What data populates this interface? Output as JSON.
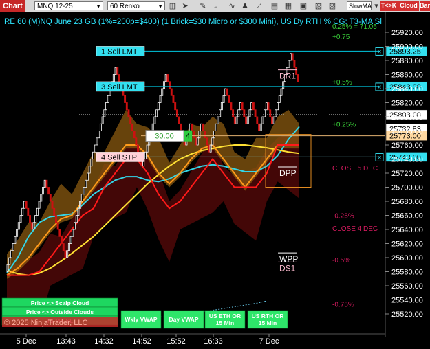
{
  "toolbar": {
    "app_label": "Chart",
    "instrument": "MNQ 12-25",
    "bar_type": "60 Renko",
    "indicator_select": "SlowMA",
    "btn_tk": "T<>K",
    "btn_cloud": "Cloud",
    "btn_bar": "Bar"
  },
  "colors": {
    "background": "#000000",
    "bull_brick": "#ffffff",
    "bear_brick": "#cc1111",
    "scalp_cloud": "#8a5a10",
    "outer_cloud": "#5a0a0a",
    "tenkan": "#ff9a1a",
    "kijun": "#ff1a1a",
    "ema_fast": "#33d6e8",
    "ema_slow": "#ffe033",
    "order_line": "#00c8e0",
    "price_tag_current": "#ffffff",
    "price_tag_open": "#ffd8a0",
    "accent_red": "#c62828"
  },
  "chart_data": {
    "type": "renko",
    "title": "RE 60 (M)NQ June 23 GB (1%=200p=$400) (1 Brick=$30 Micro or $300 Mini), US Dy RTH % CG: T3-MA Sl",
    "y_axis": {
      "ticks": [
        25920.0,
        25900.0,
        25880.0,
        25860.0,
        25840.0,
        25820.0,
        25800.0,
        25780.0,
        25760.0,
        25740.0,
        25720.0,
        25700.0,
        25680.0,
        25660.0,
        25640.0,
        25620.0,
        25600.0,
        25580.0,
        25560.0,
        25540.0,
        25520.0
      ],
      "range": [
        25510,
        25940
      ]
    },
    "x_axis": {
      "ticks": [
        "5 Dec",
        "13:43",
        "14:32",
        "14:52",
        "15:52",
        "16:33",
        "7 Dec"
      ]
    },
    "grid": false,
    "price_tags": [
      {
        "value": "25893.25",
        "style": "order"
      },
      {
        "value": "25843.00",
        "style": "order"
      },
      {
        "value": "25803.00",
        "style": "current"
      },
      {
        "value": "25782.83",
        "style": "current"
      },
      {
        "value": "25773.00",
        "style": "open"
      },
      {
        "value": "25743.00",
        "style": "order"
      }
    ],
    "orders": [
      {
        "label": "1 Sell LMT",
        "price": 25893.25
      },
      {
        "label": "3 Sell LMT",
        "price": 25843.0
      },
      {
        "label": "4 Sell STP",
        "price": 25743.0
      }
    ],
    "position_box": {
      "value": "30.00",
      "quantity": "4"
    },
    "levels": [
      {
        "label": "DR1",
        "price": 25856
      },
      {
        "label": "DPP",
        "price": 25718
      },
      {
        "label": "WPP",
        "price": 25596
      },
      {
        "label": "DS1",
        "price": 25583
      }
    ],
    "percent_labels": [
      {
        "label": "+0.75",
        "price": 25914,
        "color": "#3ad13a"
      },
      {
        "label": "+0.5%",
        "price": 25850,
        "color": "#3ad13a"
      },
      {
        "label": "+0.25%",
        "price": 25790,
        "color": "#3ad13a"
      },
      {
        "label": "-0.25%",
        "price": 25660,
        "color": "#d81b60"
      },
      {
        "label": "-0.5%",
        "price": 25597,
        "color": "#d81b60"
      },
      {
        "label": "-0.75%",
        "price": 25534,
        "color": "#d81b60"
      }
    ],
    "annotations": [
      {
        "label": "CLOSE 5 DEC",
        "price": 25728,
        "color": "#d81b60"
      },
      {
        "label": "CLOSE 4 DEC",
        "price": 25642,
        "color": "#d81b60"
      },
      {
        "label": "0.25% = 71.05",
        "price": 25929,
        "color": "#3ad13a"
      }
    ],
    "bricks": {
      "size": 10,
      "start": 25580,
      "moves": [
        1,
        1,
        1,
        1,
        1,
        1,
        1,
        1,
        1,
        1,
        -1,
        -1,
        -1,
        -1,
        1,
        1,
        1,
        1,
        1,
        1,
        1,
        -1,
        -1,
        -1,
        -1,
        -1,
        -1,
        -1,
        -1,
        -1,
        -1,
        -1,
        1,
        1,
        1,
        1,
        1,
        1,
        1,
        1,
        1,
        1,
        1,
        1,
        1,
        1,
        1,
        1,
        1,
        1,
        1,
        1,
        1,
        1,
        1,
        1,
        1,
        1,
        1,
        -1,
        -1,
        -1,
        -1,
        -1,
        -1,
        -1,
        -1,
        -1,
        -1,
        -1,
        -1,
        -1,
        -1,
        1,
        1,
        1,
        1,
        1,
        1,
        1,
        1,
        1,
        1,
        1,
        1,
        1,
        -1,
        -1,
        -1,
        -1,
        -1,
        -1,
        -1,
        -1,
        -1,
        -1,
        1,
        1,
        1,
        -1,
        -1,
        -1,
        1,
        1,
        1,
        -1,
        -1,
        -1,
        -1,
        1,
        1,
        1,
        1,
        1,
        1,
        1,
        1,
        1,
        -1,
        -1,
        -1,
        -1,
        -1,
        1,
        1,
        1,
        -1,
        -1,
        -1,
        1,
        1,
        1,
        -1,
        -1,
        -1,
        -1,
        1,
        1,
        1,
        1,
        -1,
        -1,
        -1,
        1,
        1,
        1,
        1,
        1,
        1,
        1,
        1,
        1,
        1,
        -1,
        -1,
        -1,
        -1
      ]
    },
    "series": [
      {
        "name": "",
        "role": "ema_fast",
        "values": [
          25578,
          25600,
          25630,
          25650,
          25658,
          25660,
          25662,
          25675,
          25690,
          25700,
          25710,
          25715,
          25715,
          25710,
          25708,
          25712,
          25720,
          25725,
          25730,
          25732,
          25730,
          25726,
          25722,
          25722,
          25730,
          25745,
          25768,
          25786
        ]
      },
      {
        "name": "",
        "role": "ema_slow",
        "values": [
          25582,
          25577,
          25575,
          25578,
          25585,
          25595,
          25606,
          25618,
          25630,
          25645,
          25660,
          25675,
          25690,
          25705,
          25718,
          25730,
          25740,
          25747,
          25752,
          25755,
          25758,
          25760,
          25760,
          25758,
          25756,
          25753,
          25750,
          25748
        ]
      },
      {
        "name": "",
        "role": "tenkan",
        "values": [
          25575,
          25585,
          25600,
          25620,
          25640,
          25655,
          25660,
          25680,
          25700,
          25720,
          25740,
          25760,
          25760,
          25745,
          25720,
          25705,
          25720,
          25740,
          25755,
          25760,
          25740,
          25720,
          25700,
          25720,
          25740,
          25760,
          25760,
          25760
        ]
      },
      {
        "name": "",
        "role": "kijun",
        "values": [
          25575,
          25575,
          25575,
          25580,
          25600,
          25620,
          25640,
          25660,
          25670,
          25700,
          25720,
          25740,
          25740,
          25720,
          25690,
          25670,
          25680,
          25700,
          25720,
          25740,
          25720,
          25700,
          25700,
          25700,
          25720,
          25760,
          25760,
          25760
        ]
      }
    ]
  },
  "bottom_buttons": [
    {
      "label": "Price <> Scalp Cloud"
    },
    {
      "label": "Price <> Outside Clouds"
    },
    {
      "label": "T3-MA SL"
    },
    {
      "label": "Wkly VWAP"
    },
    {
      "label": "Day VWAP"
    },
    {
      "label": "US ETH OR 15 Min"
    },
    {
      "label": "US RTH OR 15 Min"
    }
  ],
  "copyright": "© 2025 NinjaTrader, LLC"
}
